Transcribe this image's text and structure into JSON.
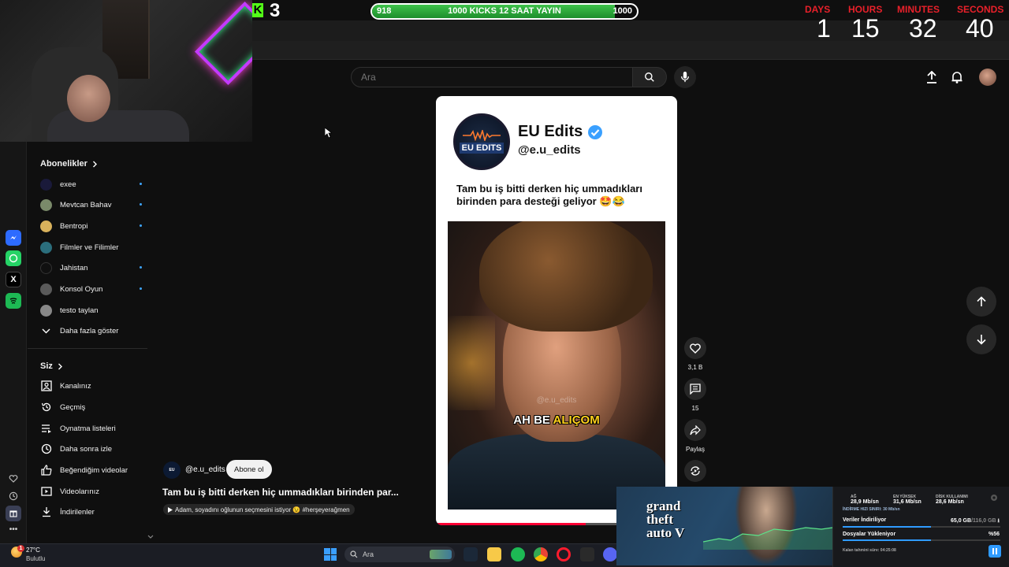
{
  "overlay": {
    "kick_count": "3",
    "goal": {
      "left": "918",
      "label": "1000 KICKS 12 SAAT YAYIN",
      "right": "1000",
      "progress": 0.918
    },
    "countdown": [
      {
        "label": "DAYS",
        "value": "1"
      },
      {
        "label": "HOURS",
        "value": "15"
      },
      {
        "label": "MINUTES",
        "value": "32"
      },
      {
        "label": "SECONDS",
        "value": "40"
      }
    ]
  },
  "header": {
    "search_placeholder": "Ara",
    "icons": [
      "search-icon",
      "mic-icon",
      "upload-icon",
      "bell-icon",
      "avatar"
    ]
  },
  "sidebar": {
    "subs_title": "Abonelikler",
    "subs": [
      {
        "label": "exee",
        "color": "#1a1a3a",
        "dot": true
      },
      {
        "label": "Mevtcan Bahav",
        "color": "#7a8a6a",
        "dot": true
      },
      {
        "label": "Bentropi",
        "color": "#d9b25c",
        "dot": true
      },
      {
        "label": "Filmler ve Filimler",
        "color": "#2b6e7c",
        "dot": false
      },
      {
        "label": "Jahistan",
        "color": "#101010",
        "dot": true
      },
      {
        "label": "Konsol Oyun",
        "color": "#5a5a5a",
        "dot": true
      },
      {
        "label": "testo taylan",
        "color": "#888888",
        "dot": false
      }
    ],
    "show_more": "Daha fazla göster",
    "you_title": "Siz",
    "you": [
      {
        "label": "Kanalınız",
        "icon": "channel-icon"
      },
      {
        "label": "Geçmiş",
        "icon": "history-icon"
      },
      {
        "label": "Oynatma listeleri",
        "icon": "playlist-icon"
      },
      {
        "label": "Daha sonra izle",
        "icon": "clock-icon"
      },
      {
        "label": "Beğendiğim videolar",
        "icon": "like-icon"
      },
      {
        "label": "Videolarınız",
        "icon": "video-icon"
      },
      {
        "label": "İndirilenler",
        "icon": "download-icon"
      }
    ]
  },
  "short": {
    "card_name": "EU Edits",
    "card_handle": "@e.u_edits",
    "logo_text": "EU EDITS",
    "caption": "Tam bu iş bitti derken hiç ummadıkları birinden para desteği geliyor 🤩😂",
    "watermark": "@e.u_edits",
    "subtitle_white": "AH BE ",
    "subtitle_yellow": "ALIÇOM",
    "progress": 0.62,
    "channel_handle": "@e.u_edits",
    "subscribe_label": "Abone ol",
    "title": "Tam bu iş bitti derken hiç ummadıkları birinden par...",
    "sound": "Adam, soyadını oğlunun seçmesini istiyor 😉 #herşeyerağmen",
    "likes": "3,1 B",
    "comments": "15",
    "share_label": "Paylaş"
  },
  "taskbar": {
    "weather_badge": "1",
    "temp": "27°C",
    "weather": "Bulutlu",
    "search": "Ara"
  },
  "downloads": {
    "net_label": "AĞ",
    "net_val": "28,9 Mb/sn",
    "peak_label": "EN YÜKSEK",
    "peak_val": "31,6 Mb/sn",
    "disk_label": "DİSK KULLANIMI",
    "disk_val": "28,6 Mb/sn",
    "limit": "İNDİRME HIZI SINIRI: 30 Mb/sn",
    "row1_label": "Veriler İndiriliyor",
    "row1_val": "65,0 GB",
    "row1_total": "/116,0 GB",
    "row1_progress": 0.56,
    "row2_label": "Dosyalar Yükleniyor",
    "row2_val": "%56",
    "row2_progress": 0.56,
    "eta": "Kalan tahmini süre: 04:25:08",
    "gta_logo": "grand theft auto V"
  }
}
